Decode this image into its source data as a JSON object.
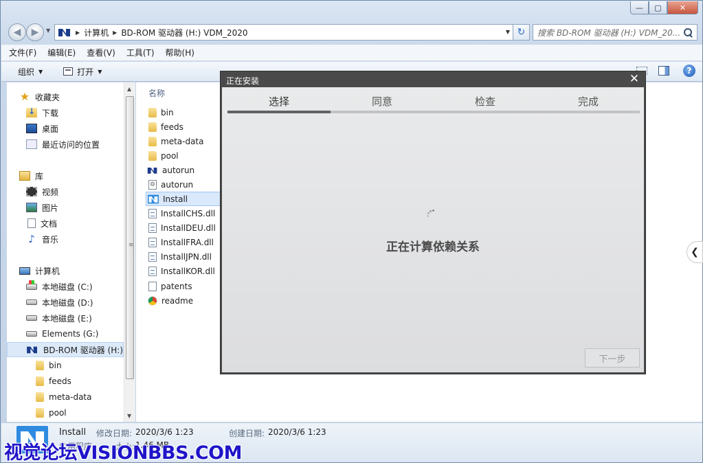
{
  "window": {
    "caption_buttons": {
      "min": "—",
      "max": "▢",
      "close": "✕"
    }
  },
  "navbar": {
    "breadcrumb": [
      "计算机",
      "BD-ROM 驱动器 (H:) VDM_2020"
    ],
    "search_placeholder": "搜索 BD-ROM 驱动器 (H:) VDM_20..."
  },
  "menubar": {
    "items": [
      "文件(F)",
      "编辑(E)",
      "查看(V)",
      "工具(T)",
      "帮助(H)"
    ]
  },
  "toolbar": {
    "organize": "组织",
    "open": "打开"
  },
  "navpane": {
    "favorites": {
      "label": "收藏夹",
      "items": [
        "下载",
        "桌面",
        "最近访问的位置"
      ]
    },
    "libraries": {
      "label": "库",
      "items": [
        "视频",
        "图片",
        "文档",
        "音乐"
      ]
    },
    "computer": {
      "label": "计算机",
      "drives": [
        "本地磁盘 (C:)",
        "本地磁盘 (D:)",
        "本地磁盘 (E:)",
        "Elements (G:)",
        "BD-ROM 驱动器 (H:)"
      ],
      "subfolders": [
        "bin",
        "feeds",
        "meta-data",
        "pool"
      ]
    }
  },
  "filelist": {
    "column_name": "名称",
    "files": [
      {
        "name": "bin",
        "icon": "folder-icon"
      },
      {
        "name": "feeds",
        "icon": "folder-icon"
      },
      {
        "name": "meta-data",
        "icon": "folder-icon"
      },
      {
        "name": "pool",
        "icon": "folder-icon"
      },
      {
        "name": "autorun",
        "icon": "ni-logo-icon"
      },
      {
        "name": "autorun",
        "icon": "inf-icon"
      },
      {
        "name": "Install",
        "icon": "ni-logo-icon"
      },
      {
        "name": "InstallCHS.dll",
        "icon": "dll-icon"
      },
      {
        "name": "InstallDEU.dll",
        "icon": "dll-icon"
      },
      {
        "name": "InstallFRA.dll",
        "icon": "dll-icon"
      },
      {
        "name": "InstallJPN.dll",
        "icon": "dll-icon"
      },
      {
        "name": "InstallKOR.dll",
        "icon": "dll-icon"
      },
      {
        "name": "patents",
        "icon": "txt-icon"
      },
      {
        "name": "readme",
        "icon": "chrome-icon"
      }
    ],
    "selected": "Install"
  },
  "details": {
    "name": "Install",
    "type": "应用程序",
    "modified_label": "修改日期:",
    "modified_value": "2020/3/6 1:23",
    "size_label": "大小:",
    "size_value": "1.46 MB",
    "created_label": "创建日期:",
    "created_value": "2020/3/6 1:23"
  },
  "watermark": "视觉论坛VISIONBBS.COM",
  "installer": {
    "title": "正在安装",
    "close": "✕",
    "steps": [
      "选择",
      "同意",
      "检查",
      "完成"
    ],
    "current_step": 1,
    "status": "正在计算依赖关系",
    "next_button": "下一步"
  },
  "colors": {
    "dialog_frame": "#4a4a4a",
    "dialog_body": "#e9eaeb",
    "selection": "#d9e8fb",
    "watermark": "#1f14c8"
  }
}
